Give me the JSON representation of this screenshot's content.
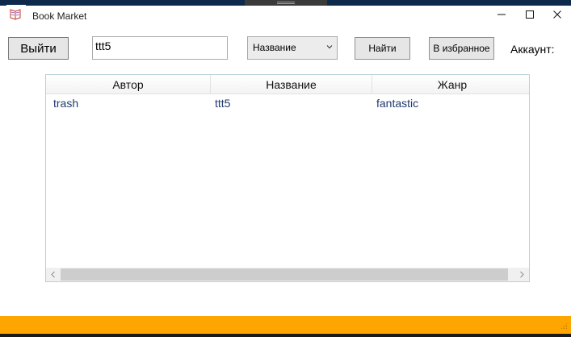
{
  "window": {
    "title": "Book Market"
  },
  "toolbar": {
    "exit_label": "Выйти",
    "search_value": "ttt5",
    "filter_selected": "Название",
    "find_label": "Найти",
    "favorites_label": "В избранное",
    "account_label": "Аккаунт:"
  },
  "grid": {
    "columns": [
      "Автор",
      "Название",
      "Жанр"
    ],
    "rows": [
      [
        "trash",
        "ttt5",
        "fantastic"
      ]
    ]
  },
  "colors": {
    "status_strip": "#ffa500",
    "cell_text": "#1e3a6e",
    "grid_border": "#b7d1d8"
  }
}
